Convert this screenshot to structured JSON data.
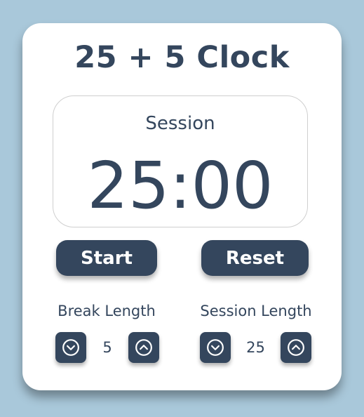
{
  "app": {
    "title": "25 + 5 Clock"
  },
  "timer": {
    "label": "Session",
    "time": "25:00"
  },
  "controls": {
    "start_label": "Start",
    "reset_label": "Reset"
  },
  "break": {
    "label": "Break Length",
    "value": "5"
  },
  "session": {
    "label": "Session Length",
    "value": "25"
  },
  "icons": {
    "decrement": "chevron-down-circle-icon",
    "increment": "chevron-up-circle-icon"
  },
  "colors": {
    "background": "#a9c8da",
    "card": "#ffffff",
    "primary": "#34465d"
  }
}
